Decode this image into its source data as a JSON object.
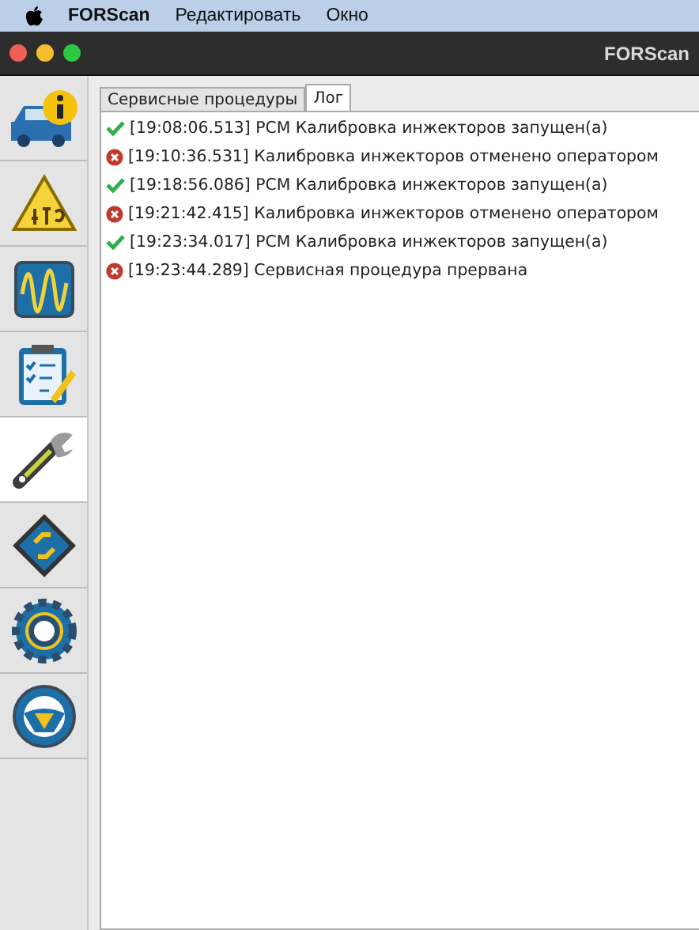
{
  "menu_bar": {
    "items": [
      {
        "label": "FORScan",
        "bold": true
      },
      {
        "label": "Редактировать",
        "bold": false
      },
      {
        "label": "Окно",
        "bold": false
      }
    ]
  },
  "window": {
    "title": "FORScan"
  },
  "sidebar": {
    "items": [
      {
        "kind": "info",
        "selected": false
      },
      {
        "kind": "dtc",
        "selected": false
      },
      {
        "kind": "oscilloscope",
        "selected": false
      },
      {
        "kind": "checklist",
        "selected": false
      },
      {
        "kind": "wrench",
        "selected": true
      },
      {
        "kind": "chip",
        "selected": false
      },
      {
        "kind": "gear",
        "selected": false
      },
      {
        "kind": "help",
        "selected": false
      }
    ]
  },
  "tabs": [
    {
      "label": "Сервисные процедуры",
      "selected": false
    },
    {
      "label": "Лог",
      "selected": true
    }
  ],
  "log": [
    {
      "kind": "success",
      "text": "[19:08:06.513] PCM Калибровка инжекторов запущен(а)"
    },
    {
      "kind": "error",
      "text": "[19:10:36.531] Калибровка инжекторов отменено оператором"
    },
    {
      "kind": "success",
      "text": "[19:18:56.086] PCM Калибровка инжекторов запущен(а)"
    },
    {
      "kind": "error",
      "text": "[19:21:42.415] Калибровка инжекторов отменено оператором"
    },
    {
      "kind": "success",
      "text": "[19:23:34.017] PCM Калибровка инжекторов запущен(а)"
    },
    {
      "kind": "error",
      "text": "[19:23:44.289] Сервисная процедура прервана"
    }
  ]
}
